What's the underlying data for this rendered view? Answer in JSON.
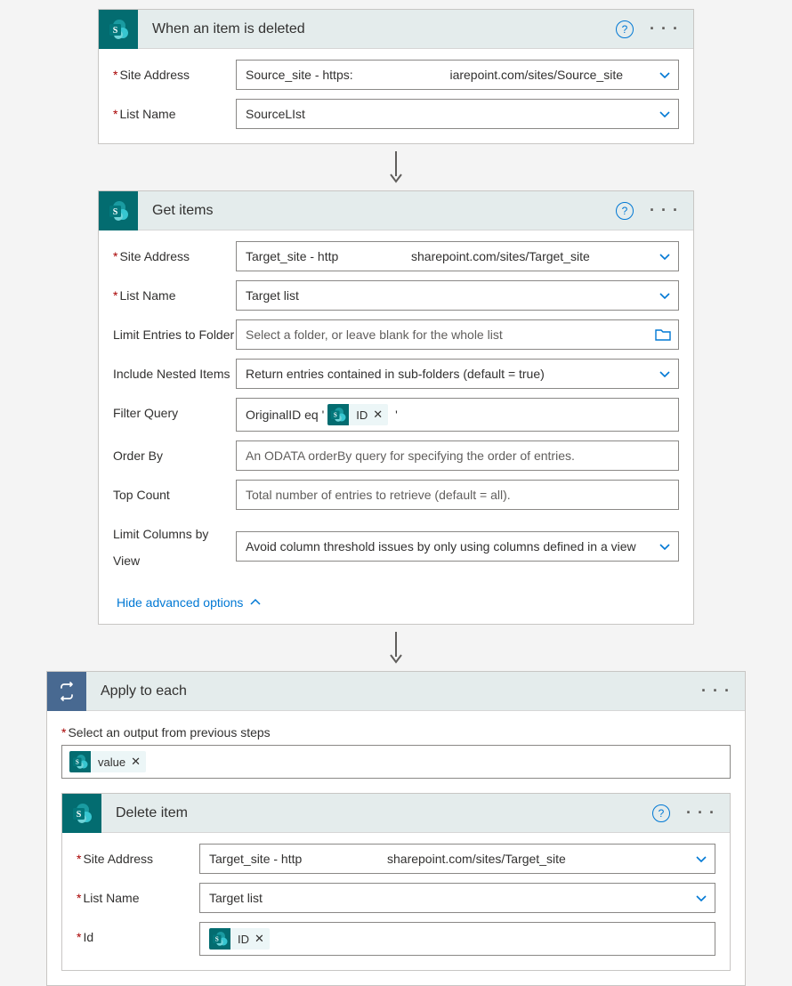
{
  "step1": {
    "title": "When an item is deleted",
    "fields": {
      "site_address": {
        "label": "Site Address",
        "required": true,
        "value_left": "Source_site - https:",
        "value_right": "iarepoint.com/sites/Source_site"
      },
      "list_name": {
        "label": "List Name",
        "required": true,
        "value": "SourceLIst"
      }
    }
  },
  "step2": {
    "title": "Get items",
    "fields": {
      "site_address": {
        "label": "Site Address",
        "required": true,
        "value_left": "Target_site - http",
        "value_right": "sharepoint.com/sites/Target_site"
      },
      "list_name": {
        "label": "List Name",
        "required": true,
        "value": "Target list"
      },
      "limit_folder": {
        "label": "Limit Entries to Folder",
        "placeholder": "Select a folder, or leave blank for the whole list"
      },
      "include_nested": {
        "label": "Include Nested Items",
        "value": "Return entries contained in sub-folders (default = true)"
      },
      "filter_query": {
        "label": "Filter Query",
        "prefix": "OriginalID eq '",
        "token": "ID",
        "suffix": "'"
      },
      "order_by": {
        "label": "Order By",
        "placeholder": "An ODATA orderBy query for specifying the order of entries."
      },
      "top_count": {
        "label": "Top Count",
        "placeholder": "Total number of entries to retrieve (default = all)."
      },
      "limit_columns": {
        "label": "Limit Columns by View",
        "value": "Avoid column threshold issues by only using columns defined in a view"
      }
    },
    "adv_link": "Hide advanced options"
  },
  "step3": {
    "title": "Apply to each",
    "select_label": "Select an output from previous steps",
    "token": "value",
    "nested": {
      "title": "Delete item",
      "fields": {
        "site_address": {
          "label": "Site Address",
          "required": true,
          "value_left": "Target_site - http",
          "value_right": "sharepoint.com/sites/Target_site"
        },
        "list_name": {
          "label": "List Name",
          "required": true,
          "value": "Target list"
        },
        "id": {
          "label": "Id",
          "required": true,
          "token": "ID"
        }
      }
    }
  }
}
